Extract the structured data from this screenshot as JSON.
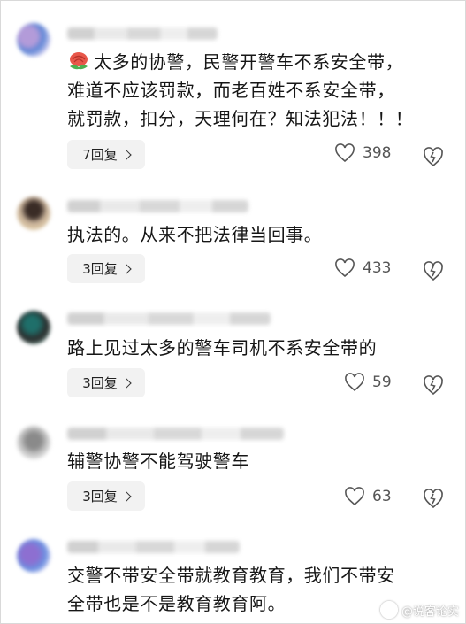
{
  "comments": [
    {
      "text_line1": "太多的协警，民警开警车不系安全带，",
      "text_line2": "难道不应该罚款，而老百姓不系安全带，",
      "text_line3": "就罚款，扣分，天理何在？知法犯法！！！",
      "emoji": "rose-emoji",
      "reply_label": "7回复",
      "likes": "398"
    },
    {
      "text_line1": "执法的。从来不把法律当回事。",
      "reply_label": "3回复",
      "likes": "433"
    },
    {
      "text_line1": "路上见过太多的警车司机不系安全带的",
      "reply_label": "3回复",
      "likes": "59"
    },
    {
      "text_line1": "辅警协警不能驾驶警车",
      "reply_label": "3回复",
      "likes": "63"
    },
    {
      "text_line1": "交警不带安全带就教育教育，我们不带安",
      "text_line2": "全带也是不是教育教育阿。"
    }
  ],
  "icons": {
    "like": "heart-outline-icon",
    "dislike": "broken-heart-icon",
    "reply": "chevron-right-icon"
  },
  "colors": {
    "text": "#161616",
    "meta": "#555555",
    "button_bg": "#f2f2f2"
  },
  "watermark": {
    "label": "@说客论实"
  }
}
